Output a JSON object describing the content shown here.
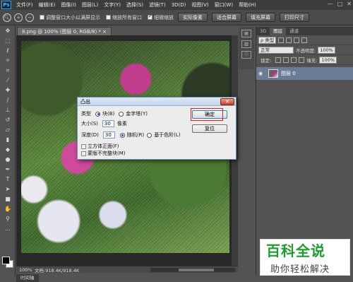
{
  "app": {
    "logo": "Ps"
  },
  "menu": [
    "文件(F)",
    "编辑(E)",
    "图像(I)",
    "图层(L)",
    "文字(Y)",
    "选择(S)",
    "滤镜(T)",
    "3D(D)",
    "视图(V)",
    "窗口(W)",
    "帮助(H)"
  ],
  "window_controls": {
    "minimize": "—",
    "restore": "□",
    "close": "✕"
  },
  "options": {
    "check1_label": "调整窗口大小以满屏显示",
    "check1_checked": false,
    "check2_label": "缩放所有窗口",
    "check2_checked": false,
    "check3_label": "细微缩放",
    "check3_checked": true,
    "btn_actual": "实际像素",
    "btn_fit": "适合屏幕",
    "btn_fill": "填充屏幕",
    "btn_print": "打印尺寸"
  },
  "document": {
    "tab_title": "8.png @ 100% (图层 0, RGB/8) * ×",
    "zoom": "100%",
    "doc_info": "文档:918.4K/918.4K"
  },
  "timeline_tab": "时间轴",
  "panel": {
    "tabs": [
      "3D",
      "图层",
      "通道"
    ],
    "filter_kind": "ρ 类型",
    "blend_mode": "正常",
    "opacity_label": "不透明度:",
    "opacity_value": "100%",
    "lock_label": "锁定:",
    "fill_label": "填充:",
    "fill_value": "100%",
    "layer_name": "图层 0"
  },
  "dialog": {
    "title": "凸出",
    "type_label": "类型",
    "type_block": "块(B)",
    "type_pyramid": "金字塔(Y)",
    "size_label": "大小(S)",
    "size_value": "30",
    "size_unit": "像素",
    "depth_label": "深度(D)",
    "depth_value": "30",
    "depth_random": "随机(R)",
    "depth_level": "基于色阶(L)",
    "solid_front": "立方体正面(F)",
    "mask_incomplete": "蒙版不完整块(M)",
    "ok": "确定",
    "reset": "复位",
    "close": "✕"
  },
  "watermark": {
    "title": "百科全说",
    "subtitle": "助你轻松解决"
  },
  "icons": [
    "zoom-icon",
    "zoom-in-icon",
    "zoom-out-icon",
    "move-tool-icon",
    "marquee-tool-icon",
    "lasso-tool-icon",
    "magic-wand-icon",
    "crop-tool-icon",
    "eyedropper-icon",
    "healing-brush-icon",
    "brush-tool-icon",
    "clone-stamp-icon",
    "history-brush-icon",
    "eraser-icon",
    "gradient-icon",
    "blur-icon",
    "dodge-icon",
    "pen-tool-icon",
    "type-tool-icon",
    "path-selection-icon",
    "shape-tool-icon",
    "hand-tool-icon",
    "zoom-tool-icon",
    "eye-icon"
  ]
}
